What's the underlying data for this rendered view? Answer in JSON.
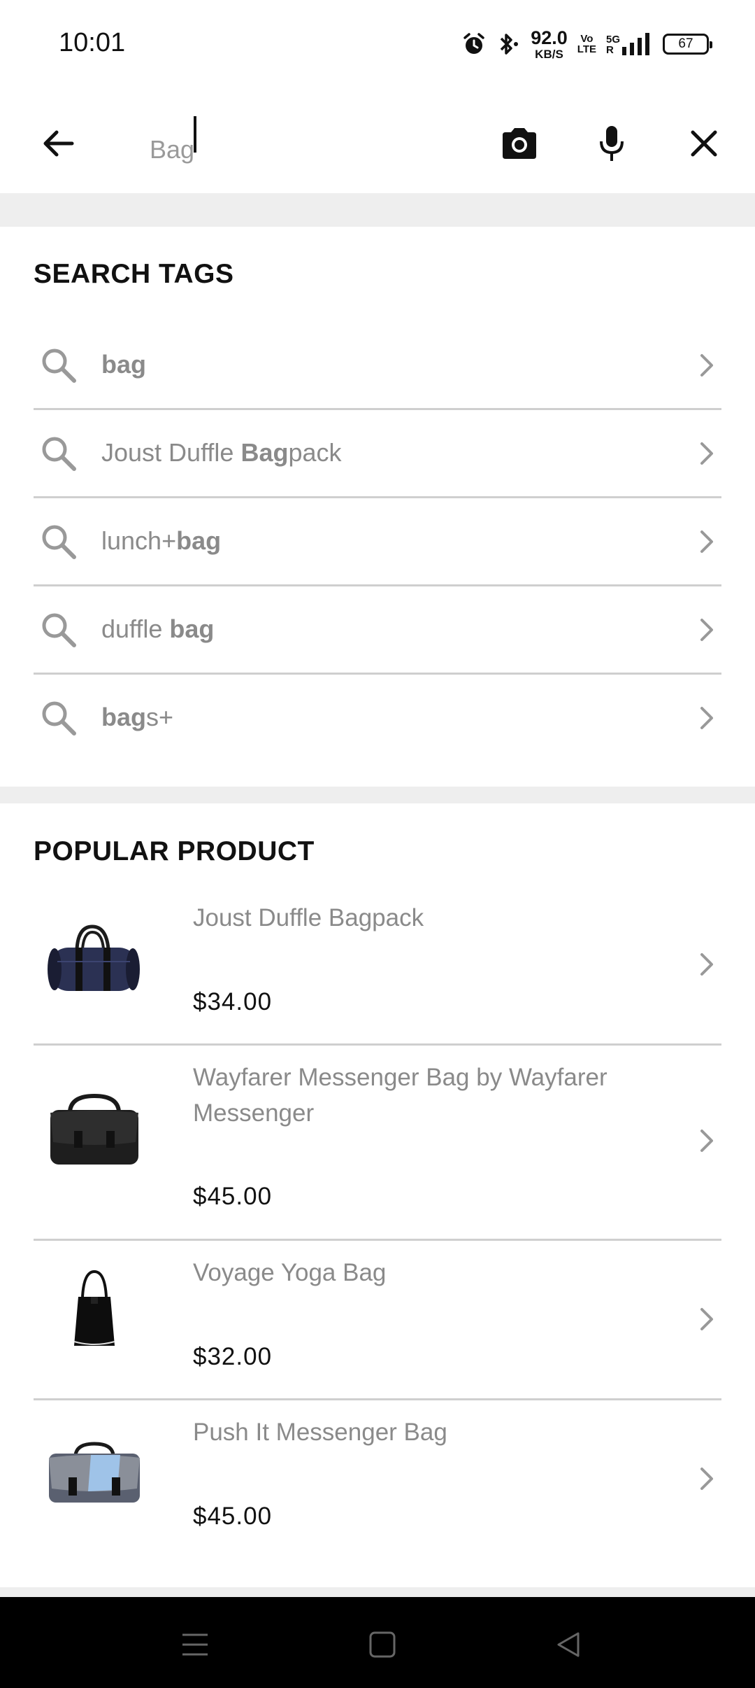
{
  "status_bar": {
    "time": "10:01",
    "net_speed_value": "92.0",
    "net_speed_unit": "KB/S",
    "volte_top": "Vo",
    "volte_bottom": "LTE",
    "network_label": "5G",
    "battery": "67"
  },
  "search": {
    "query": "Bag",
    "icons": [
      "back-arrow-icon",
      "camera-icon",
      "microphone-icon",
      "close-icon"
    ]
  },
  "search_tags": {
    "title": "SEARCH TAGS",
    "items": [
      {
        "before": "",
        "match": "bag",
        "after": ""
      },
      {
        "before": "Joust Duffle ",
        "match": "Bag",
        "after": "pack"
      },
      {
        "before": "lunch+",
        "match": "bag",
        "after": ""
      },
      {
        "before": "duffle ",
        "match": "bag",
        "after": ""
      },
      {
        "before": "",
        "match": "bag",
        "after": "s+"
      }
    ]
  },
  "popular_product": {
    "title": "POPULAR PRODUCT",
    "items": [
      {
        "name": "Joust Duffle Bagpack",
        "price": "$34.00",
        "image": "duffle-bag"
      },
      {
        "name": "Wayfarer Messenger Bag by Wayfarer Messenger",
        "price": "$45.00",
        "image": "messenger-bag"
      },
      {
        "name": "Voyage Yoga Bag",
        "price": "$32.00",
        "image": "tote-bag"
      },
      {
        "name": "Push It Messenger Bag",
        "price": "$45.00",
        "image": "blue-messenger-bag"
      }
    ]
  },
  "nav_bar": {
    "icons": [
      "menu-icon",
      "home-icon",
      "back-triangle-icon"
    ]
  },
  "colors": {
    "text_muted": "#8a8a8a",
    "divider": "#cfcfcf",
    "band": "#eeeeee",
    "nav_bar": "#000000"
  }
}
